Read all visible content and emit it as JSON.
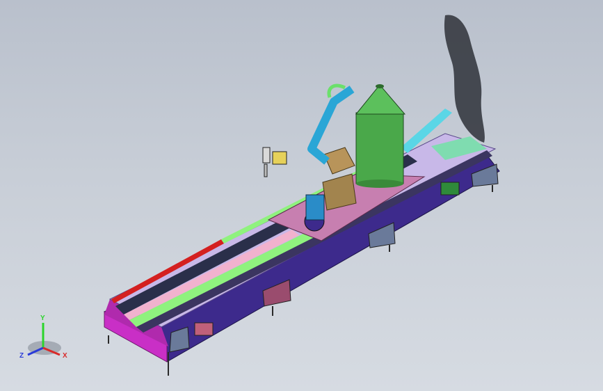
{
  "viewport": {
    "background_top": "#b9c0cc",
    "background_bottom": "#d6dbe2"
  },
  "model": {
    "colors": {
      "base_magenta": "#c92fc6",
      "base_purple": "#3d2a8c",
      "rail_red": "#d42020",
      "rail_green": "#8ff27e",
      "rail_pink": "#f1b2ce",
      "rail_cyan": "#5ad6e6",
      "rail_dark": "#2a2f4a",
      "carriage_plate": "#c77fb0",
      "robot_arm": "#2aa6d6",
      "robot_base": "#a2844e",
      "hopper_green": "#4aa84a",
      "shadow": "#3a3d44"
    }
  },
  "triad": {
    "y_label": "Y",
    "z_label": "Z",
    "x_label": "X",
    "y_color": "#2bd42b",
    "z_color": "#2a3bd8",
    "x_color": "#d82a2a"
  }
}
